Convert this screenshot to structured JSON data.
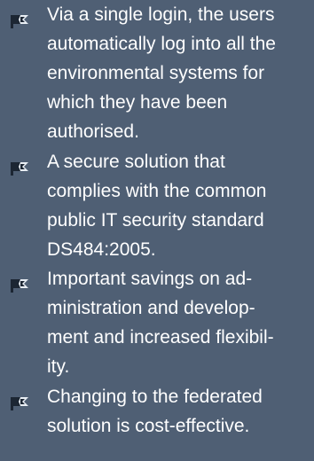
{
  "heading_fragment": "",
  "icons": {
    "bullet": "flag-icon"
  },
  "colors": {
    "background": "#4f5f74",
    "text": "#ffffff",
    "icon_dark": "#1c2633",
    "icon_light": "#e9eef4"
  },
  "bullets": [
    {
      "lines": [
        "Via a single login, the users",
        "automatically log into all the",
        "environmental systems for",
        "which they have been",
        "authorised."
      ]
    },
    {
      "lines": [
        "A secure solution that",
        "complies with the common",
        "public IT security standard",
        "DS484:2005."
      ]
    },
    {
      "lines": [
        "Important savings on ad-",
        "ministration and develop-",
        "ment and increased flexibil-",
        "ity."
      ]
    },
    {
      "lines": [
        "Changing to the federated",
        "solution is cost-effective."
      ]
    }
  ]
}
